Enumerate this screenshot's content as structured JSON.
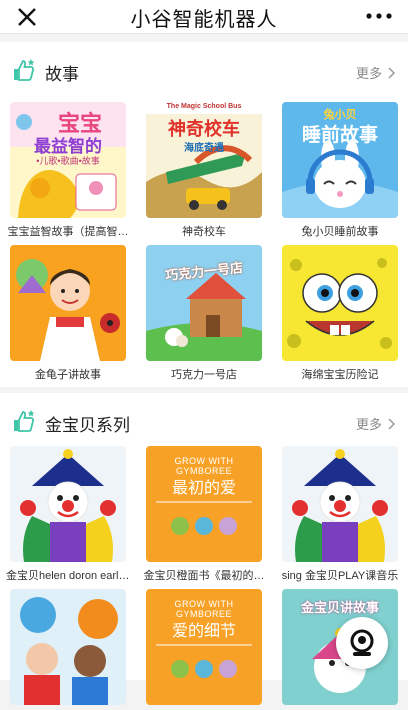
{
  "header": {
    "title": "小谷智能机器人"
  },
  "sections": [
    {
      "title": "故事",
      "more": "更多",
      "items": [
        {
          "caption": "宝宝益智故事（提高智…",
          "cover_title": "宝宝",
          "cover_sub": "最益智的",
          "cover_tag": "•儿歌•歌曲•故事"
        },
        {
          "caption": "神奇校车",
          "cover_title": "神奇校车",
          "cover_sub": "海底奇遇",
          "cover_tag": "The Magic School Bus"
        },
        {
          "caption": "兔小贝睡前故事",
          "cover_title": "睡前故事",
          "cover_sub": "兔小贝"
        },
        {
          "caption": "金龟子讲故事"
        },
        {
          "caption": "巧克力一号店",
          "cover_title": "巧克力一号店"
        },
        {
          "caption": "海绵宝宝历险记"
        }
      ]
    },
    {
      "title": "金宝贝系列",
      "more": "更多",
      "items": [
        {
          "caption": "金宝贝helen doron early e…"
        },
        {
          "caption": "金宝贝橙面书《最初的…",
          "cover_top": "GROW WITH GYMBOREE",
          "cover_title": "最初的爱"
        },
        {
          "caption": "sing 金宝贝PLAY课音乐"
        },
        {
          "caption": ""
        },
        {
          "caption": "",
          "cover_top": "GROW WITH GYMBOREE",
          "cover_title": "爱的细节"
        },
        {
          "caption": "",
          "cover_title": "金宝贝讲故事"
        }
      ]
    }
  ]
}
